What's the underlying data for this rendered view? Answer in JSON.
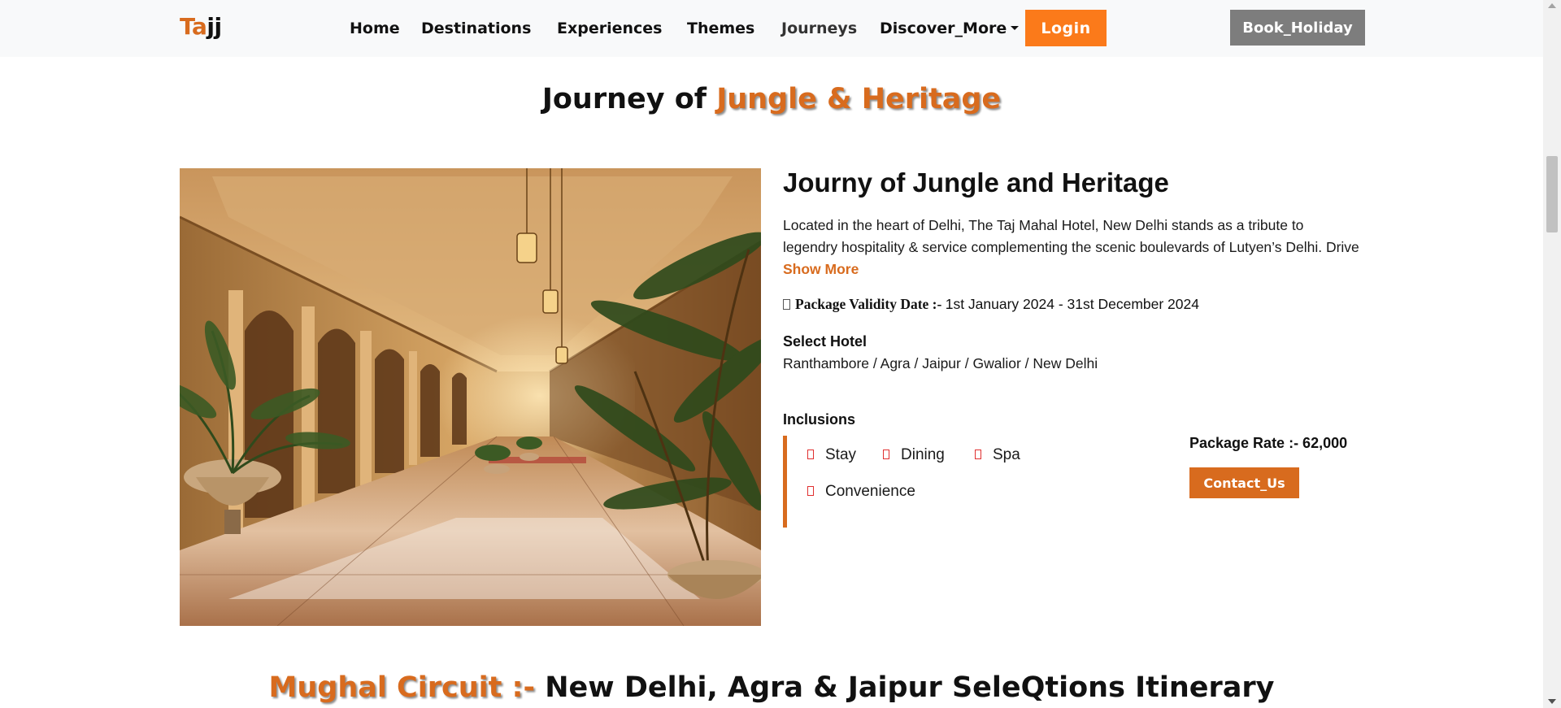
{
  "nav": {
    "logo_part1": "Ta",
    "logo_part2": "jj",
    "items": [
      "Home",
      "Destinations",
      "Experiences",
      "Themes",
      "Journeys",
      "Discover_More"
    ],
    "login": "Login",
    "book": "Book_Holiday"
  },
  "section1": {
    "title_prefix": "Journey of ",
    "title_accent": "Jungle & Heritage"
  },
  "package": {
    "title": "Journy of Jungle and Heritage",
    "description": "Located in the heart of Delhi, The Taj Mahal Hotel, New Delhi stands as a tribute to legendry hospitality & service complementing the scenic boulevards of Lutyen’s Delhi. Drive ",
    "show_more": "Show More",
    "validity_label": "Package Validity Date :- ",
    "validity_value": "1st January 2024 - 31st December 2024",
    "select_hotel_label": "Select Hotel",
    "hotels": "Ranthambore / Agra / Jaipur / Gwalior / New Delhi",
    "inclusions_label": "Inclusions",
    "inclusions": [
      "Stay",
      "Dining",
      "Spa",
      "Convenience"
    ],
    "rate": "Package Rate :- 62,000",
    "contact": "Contact_Us"
  },
  "section2": {
    "title_accent": "Mughal Circuit :- ",
    "title_rest": "New Delhi, Agra & Jaipur SeleQtions Itinerary"
  },
  "colors": {
    "accent": "#d86b1e",
    "login_bg": "#fb7a1a",
    "book_bg": "#7d7d7d",
    "navbar_bg": "#f8f9fa"
  },
  "icons": {
    "hero_image": "hotel-corridor-image",
    "inclusion_bullet": "missing-glyph-icon"
  }
}
